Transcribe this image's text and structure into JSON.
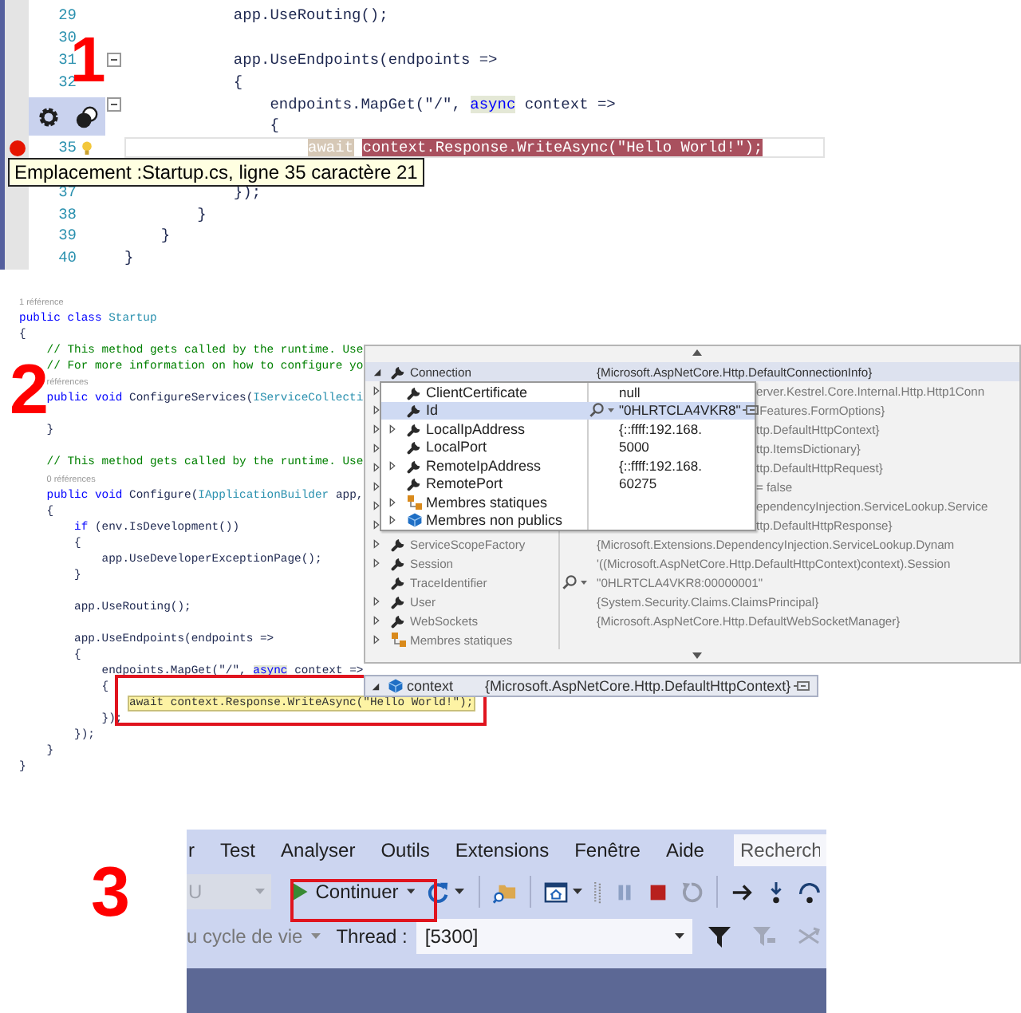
{
  "panel_1": {
    "step": "1",
    "lines": [
      {
        "number": "29",
        "kind": "code",
        "tokens": [
          {
            "kind": "plain",
            "text": "            app.UseRouting();"
          }
        ]
      },
      {
        "number": "30",
        "kind": "blank"
      },
      {
        "number": "31",
        "kind": "code",
        "fold": true,
        "tokens": [
          {
            "kind": "plain",
            "text": "            app.UseEndpoints(endpoints =>"
          }
        ]
      },
      {
        "number": "32",
        "kind": "code",
        "tokens": [
          {
            "kind": "plain",
            "text": "            {"
          }
        ]
      },
      {
        "kind": "code",
        "fold": true,
        "tokens": [
          {
            "kind": "plain",
            "text": "                endpoints.MapGet(\"/\", "
          },
          {
            "kind": "keyword-hl",
            "text": "async"
          },
          {
            "kind": "plain",
            "text": " context =>"
          }
        ]
      },
      {
        "kind": "code",
        "tokens": [
          {
            "kind": "plain",
            "text": "                {"
          }
        ]
      },
      {
        "number": "35",
        "kind": "code",
        "breakpoint": true,
        "lightbulb": true,
        "current": true,
        "tokens": [
          {
            "kind": "ref-hl",
            "text": "                    await"
          },
          {
            "kind": "breakpoint",
            "text": " context.Response.WriteAsync(\"Hello World!\");"
          }
        ]
      },
      {
        "kind": "blank"
      },
      {
        "number": "37",
        "kind": "code",
        "tokens": [
          {
            "kind": "plain",
            "text": "            });"
          }
        ]
      },
      {
        "number": "38",
        "kind": "code",
        "tokens": [
          {
            "kind": "plain",
            "text": "        }"
          }
        ]
      },
      {
        "number": "39",
        "kind": "code",
        "tokens": [
          {
            "kind": "plain",
            "text": "    }"
          }
        ]
      },
      {
        "number": "40",
        "kind": "code",
        "tokens": [
          {
            "kind": "plain",
            "text": "}"
          }
        ]
      }
    ],
    "tooltip": "Emplacement :Startup.cs, ligne 35 caractère 21"
  },
  "panel_2": {
    "step": "2",
    "lines": [
      {
        "kind": "code",
        "tokens": [
          {
            "kind": "lens",
            "text": "1 référence"
          }
        ]
      },
      {
        "kind": "code",
        "tokens": [
          {
            "kind": "keyword",
            "text": "public class "
          },
          {
            "kind": "type",
            "text": "Startup"
          }
        ]
      },
      {
        "kind": "code",
        "tokens": [
          {
            "kind": "plain",
            "text": "{"
          }
        ]
      },
      {
        "kind": "code",
        "tokens": [
          {
            "kind": "comment",
            "text": "    // This method gets called by the runtime. Use"
          }
        ]
      },
      {
        "kind": "code",
        "tokens": [
          {
            "kind": "comment",
            "text": "    // For more information on how to configure yo"
          }
        ]
      },
      {
        "kind": "code",
        "tokens": [
          {
            "kind": "lens",
            "text": "    références"
          }
        ]
      },
      {
        "kind": "code",
        "tokens": [
          {
            "kind": "keyword",
            "text": "    public void "
          },
          {
            "kind": "plain",
            "text": "ConfigureServices("
          },
          {
            "kind": "type",
            "text": "IServiceCollecti"
          }
        ]
      },
      {
        "kind": "blank"
      },
      {
        "kind": "code",
        "tokens": [
          {
            "kind": "plain",
            "text": "    }"
          }
        ]
      },
      {
        "kind": "blank"
      },
      {
        "kind": "code",
        "tokens": [
          {
            "kind": "comment",
            "text": "    // This method gets called by the runtime. Use"
          }
        ]
      },
      {
        "kind": "code",
        "tokens": [
          {
            "kind": "lens",
            "text": "    0 références"
          }
        ]
      },
      {
        "kind": "code",
        "tokens": [
          {
            "kind": "keyword",
            "text": "    public void "
          },
          {
            "kind": "plain",
            "text": "Configure("
          },
          {
            "kind": "type",
            "text": "IApplicationBuilder"
          },
          {
            "kind": "plain",
            "text": " app,"
          }
        ]
      },
      {
        "kind": "code",
        "tokens": [
          {
            "kind": "plain",
            "text": "    {"
          }
        ]
      },
      {
        "kind": "code",
        "tokens": [
          {
            "kind": "keyword",
            "text": "        if"
          },
          {
            "kind": "plain",
            "text": " (env.IsDevelopment())"
          }
        ]
      },
      {
        "kind": "code",
        "tokens": [
          {
            "kind": "plain",
            "text": "        {"
          }
        ]
      },
      {
        "kind": "code",
        "tokens": [
          {
            "kind": "plain",
            "text": "            app.UseDeveloperExceptionPage();"
          }
        ]
      },
      {
        "kind": "code",
        "tokens": [
          {
            "kind": "plain",
            "text": "        }"
          }
        ]
      },
      {
        "kind": "blank"
      },
      {
        "kind": "code",
        "tokens": [
          {
            "kind": "plain",
            "text": "        app.UseRouting();"
          }
        ]
      },
      {
        "kind": "blank"
      },
      {
        "kind": "code",
        "tokens": [
          {
            "kind": "plain",
            "text": "        app.UseEndpoints(endpoints =>"
          }
        ]
      },
      {
        "kind": "code",
        "tokens": [
          {
            "kind": "plain",
            "text": "        {"
          }
        ]
      },
      {
        "kind": "code",
        "tokens": [
          {
            "kind": "plain",
            "text": "            endpoints.MapGet(\"/\", "
          },
          {
            "kind": "keyword-hl",
            "text": "async"
          },
          {
            "kind": "plain",
            "text": " context =>"
          }
        ]
      },
      {
        "kind": "code",
        "tokens": [
          {
            "kind": "plain",
            "text": "            {"
          }
        ]
      },
      {
        "kind": "code",
        "tokens": [
          {
            "kind": "current",
            "text": "                await context.Response.WriteAsync(\"Hello World!\");"
          }
        ]
      },
      {
        "kind": "code",
        "tokens": [
          {
            "kind": "plain",
            "text": "            });"
          }
        ]
      },
      {
        "kind": "code",
        "tokens": [
          {
            "kind": "plain",
            "text": "        });"
          }
        ]
      },
      {
        "kind": "code",
        "tokens": [
          {
            "kind": "plain",
            "text": "    }"
          }
        ]
      },
      {
        "kind": "code",
        "tokens": [
          {
            "kind": "plain",
            "text": "}"
          }
        ]
      }
    ],
    "datatip": {
      "rows": [
        {
          "kind": "property",
          "name": "Connection",
          "value": "{Microsoft.AspNetCore.Http.DefaultConnectionInfo}",
          "expandable": true,
          "expanded": true,
          "selected": true
        },
        {
          "value": "erver.Kestrel.Core.Internal.Http.Http1Conn",
          "expandable": true,
          "expanded": false,
          "selected": false
        },
        {
          "value": ".Features.FormOptions}",
          "expandable": true,
          "expanded": false,
          "selected": false
        },
        {
          "value": "ttp.DefaultHttpContext}",
          "expandable": true,
          "expanded": false,
          "selected": false
        },
        {
          "value": "ttp.ItemsDictionary}",
          "expandable": true,
          "expanded": false,
          "selected": false
        },
        {
          "value": "ttp.DefaultHttpRequest}",
          "expandable": true,
          "expanded": false,
          "selected": false
        },
        {
          "value": "= false",
          "expandable": true,
          "expanded": false,
          "selected": false
        },
        {
          "value": "ependencyInjection.ServiceLookup.Service",
          "expandable": true,
          "expanded": false,
          "selected": false
        },
        {
          "value": "ttp.DefaultHttpResponse}",
          "expandable": true,
          "expanded": false,
          "selected": false
        },
        {
          "kind": "property",
          "name": "ServiceScopeFactory",
          "value": "{Microsoft.Extensions.DependencyInjection.ServiceLookup.Dynam",
          "expandable": true,
          "expanded": false,
          "selected": false
        },
        {
          "kind": "property",
          "name": "Session",
          "value": "'((Microsoft.AspNetCore.Http.DefaultHttpContext)context).Session",
          "expandable": true,
          "expanded": false,
          "selected": false
        },
        {
          "kind": "property",
          "name": "TraceIdentifier",
          "value": "\"0HLRTCLA4VKR8:00000001\"",
          "inspect": true,
          "expandable": false,
          "selected": false
        },
        {
          "kind": "property",
          "name": "User",
          "value": "{System.Security.Claims.ClaimsPrincipal}",
          "expandable": true,
          "expanded": false,
          "selected": false
        },
        {
          "kind": "property",
          "name": "WebSockets",
          "value": "{Microsoft.AspNetCore.Http.DefaultWebSocketManager}",
          "expandable": true,
          "expanded": false,
          "selected": false
        },
        {
          "kind": "static",
          "name": "Membres statiques",
          "expandable": true,
          "expanded": false,
          "selected": false
        }
      ]
    },
    "sub_datatip": {
      "rows": [
        {
          "kind": "property",
          "name": "ClientCertificate",
          "value": "null",
          "expandable": false,
          "selected": false
        },
        {
          "kind": "property",
          "name": "Id",
          "value": "\"0HLRTCLA4VKR8\"",
          "inspect": true,
          "pin": true,
          "expandable": false,
          "selected": true
        },
        {
          "kind": "property",
          "name": "LocalIpAddress",
          "value": "{::ffff:192.168.",
          "expandable": true,
          "expanded": false,
          "selected": false
        },
        {
          "kind": "property",
          "name": "LocalPort",
          "value": "5000",
          "expandable": false,
          "selected": false
        },
        {
          "kind": "property",
          "name": "RemoteIpAddress",
          "value": "{::ffff:192.168.",
          "expandable": true,
          "expanded": false,
          "selected": false
        },
        {
          "kind": "property",
          "name": "RemotePort",
          "value": "60275",
          "expandable": false,
          "selected": false
        },
        {
          "kind": "static",
          "name": "Membres statiques",
          "expandable": true,
          "expanded": false,
          "selected": false
        },
        {
          "kind": "object",
          "name": "Membres non publics",
          "expandable": true,
          "expanded": false,
          "selected": false
        }
      ]
    },
    "context_row": {
      "kind": "object",
      "name": "context",
      "value": "{Microsoft.AspNetCore.Http.DefaultHttpContext}",
      "expandable": true,
      "expanded": true,
      "pin": true
    }
  },
  "panel_3": {
    "step": "3",
    "menu": [
      {
        "label": "r"
      },
      {
        "label": "Test"
      },
      {
        "label": "Analyser"
      },
      {
        "label": "Outils"
      },
      {
        "label": "Extensions"
      },
      {
        "label": "Fenêtre"
      },
      {
        "label": "Aide"
      }
    ],
    "search": {
      "placeholder": "Recherch"
    },
    "config_combo": {
      "value": "U",
      "disabled": true
    },
    "continue_button": {
      "label": "Continuer"
    },
    "tools": [
      {
        "kind": "refresh",
        "dropdown": true,
        "disabled": false
      },
      {
        "kind": "separator"
      },
      {
        "kind": "find-in-files",
        "disabled": false
      },
      {
        "kind": "separator"
      },
      {
        "kind": "window",
        "dropdown": true,
        "disabled": false
      },
      {
        "kind": "grip"
      },
      {
        "kind": "pause",
        "disabled": true
      },
      {
        "kind": "stop",
        "disabled": false
      },
      {
        "kind": "restart",
        "disabled": true
      },
      {
        "kind": "separator"
      },
      {
        "kind": "next-statement",
        "disabled": false
      },
      {
        "kind": "step-into",
        "disabled": false
      },
      {
        "kind": "step-over",
        "disabled": false
      }
    ],
    "lifecycle_dropdown": {
      "label": "u cycle de vie"
    },
    "thread_label": "Thread :",
    "thread_combo": {
      "value": "[5300]"
    },
    "filters": [
      {
        "kind": "filter",
        "disabled": false
      },
      {
        "kind": "flag-filter",
        "disabled": true
      },
      {
        "kind": "cross-filter",
        "disabled": true
      }
    ]
  }
}
